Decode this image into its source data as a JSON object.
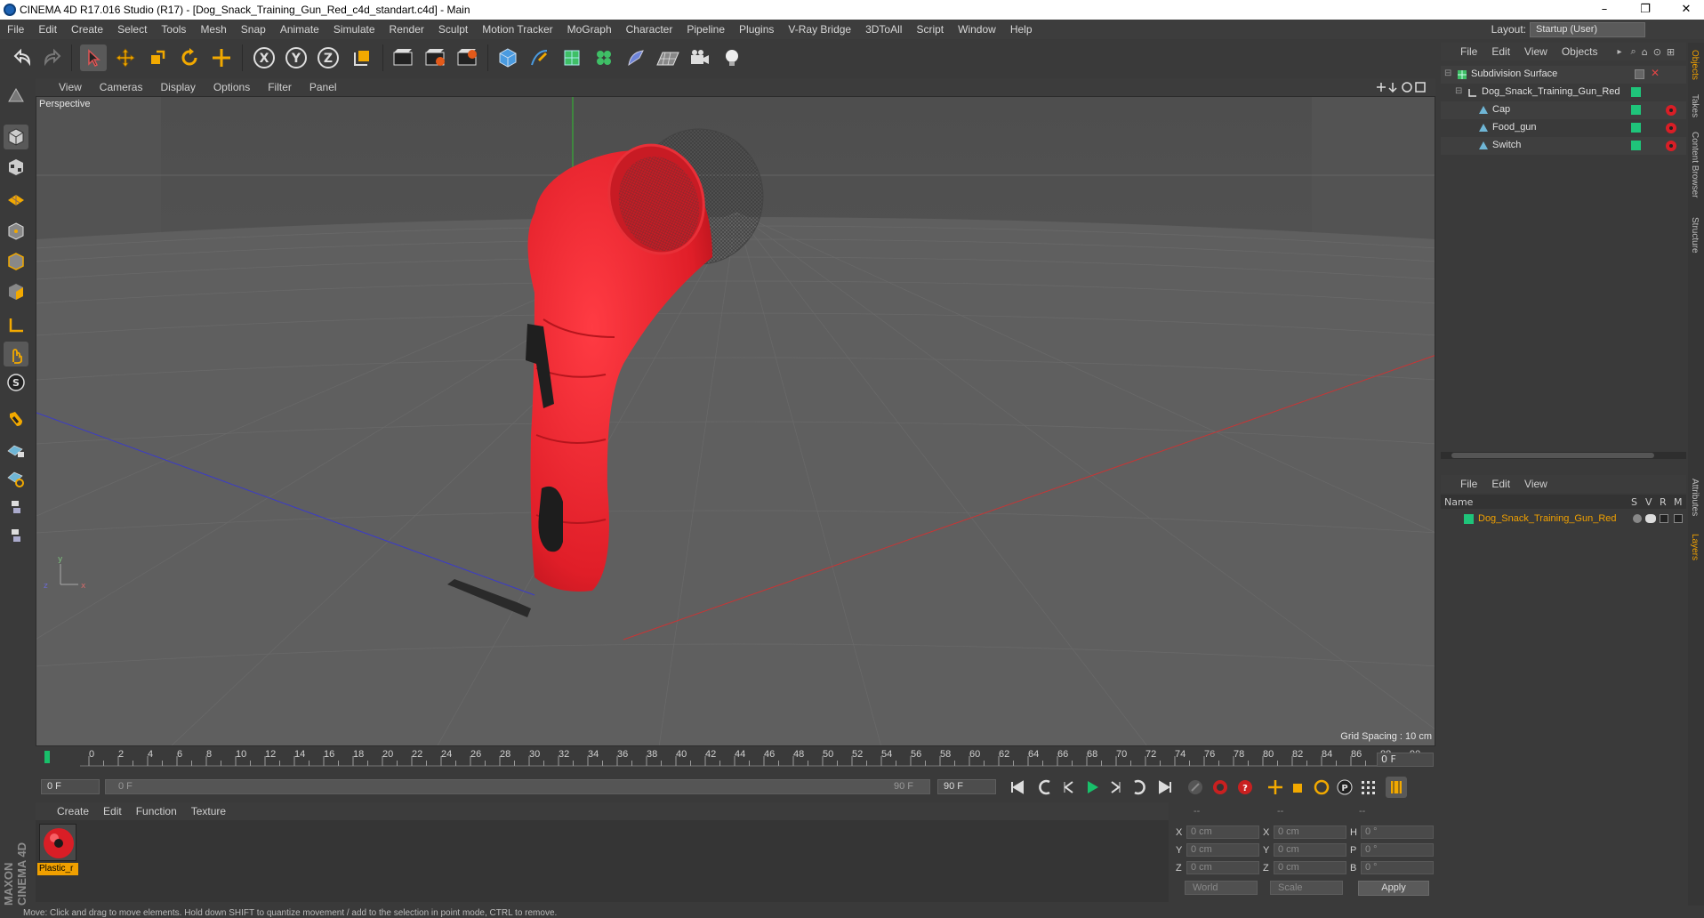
{
  "window": {
    "title": "CINEMA 4D R17.016 Studio (R17) - [Dog_Snack_Training_Gun_Red_c4d_standart.c4d] - Main",
    "minimize": "–",
    "maximize": "❐",
    "close": "✕"
  },
  "menu": [
    "File",
    "Edit",
    "Create",
    "Select",
    "Tools",
    "Mesh",
    "Snap",
    "Animate",
    "Simulate",
    "Render",
    "Sculpt",
    "Motion Tracker",
    "MoGraph",
    "Character",
    "Pipeline",
    "Plugins",
    "V-Ray Bridge",
    "3DToAll",
    "Script",
    "Window",
    "Help"
  ],
  "layout": {
    "label": "Layout:",
    "value": "Startup (User)"
  },
  "viewport": {
    "menu": [
      "View",
      "Cameras",
      "Display",
      "Options",
      "Filter",
      "Panel"
    ],
    "label": "Perspective",
    "grid_spacing": "Grid Spacing : 10 cm"
  },
  "timeline": {
    "ticks": [
      "0",
      "2",
      "4",
      "6",
      "8",
      "10",
      "12",
      "14",
      "16",
      "18",
      "20",
      "22",
      "24",
      "26",
      "28",
      "30",
      "32",
      "34",
      "36",
      "38",
      "40",
      "42",
      "44",
      "46",
      "48",
      "50",
      "52",
      "54",
      "56",
      "58",
      "60",
      "62",
      "64",
      "66",
      "68",
      "70",
      "72",
      "74",
      "76",
      "78",
      "80",
      "82",
      "84",
      "86",
      "88",
      "90"
    ],
    "current_frame": "0 F",
    "start": "0 F",
    "range_start": "0 F",
    "range_end": "90 F",
    "end": "90 F"
  },
  "materials": {
    "menu": [
      "Create",
      "Edit",
      "Function",
      "Texture"
    ],
    "items": [
      {
        "name": "Plastic_r"
      }
    ]
  },
  "coords": {
    "headers": [
      "--",
      "--",
      "--"
    ],
    "rows": [
      {
        "a": "X",
        "av": "0 cm",
        "b": "X",
        "bv": "0 cm",
        "c": "H",
        "cv": "0 °"
      },
      {
        "a": "Y",
        "av": "0 cm",
        "b": "Y",
        "bv": "0 cm",
        "c": "P",
        "cv": "0 °"
      },
      {
        "a": "Z",
        "av": "0 cm",
        "b": "Z",
        "bv": "0 cm",
        "c": "B",
        "cv": "0 °"
      }
    ],
    "space": "World",
    "mode": "Scale",
    "apply": "Apply"
  },
  "object_manager": {
    "menu": [
      "File",
      "Edit",
      "View",
      "Objects"
    ],
    "objects": [
      {
        "name": "Subdivision Surface",
        "depth": 0
      },
      {
        "name": "Dog_Snack_Training_Gun_Red",
        "depth": 1
      },
      {
        "name": "Cap",
        "depth": 2
      },
      {
        "name": "Food_gun",
        "depth": 2
      },
      {
        "name": "Switch",
        "depth": 2
      }
    ]
  },
  "layer_manager": {
    "menu": [
      "File",
      "Edit",
      "View"
    ],
    "columns": {
      "name": "Name",
      "s": "S",
      "v": "V",
      "r": "R",
      "m": "M"
    },
    "layers": [
      {
        "name": "Dog_Snack_Training_Gun_Red"
      }
    ]
  },
  "right_tabs": [
    "Objects",
    "Takes",
    "Content Browser",
    "Structure",
    "Attributes",
    "Layers"
  ],
  "status": "Move: Click and drag to move elements. Hold down SHIFT to quantize movement / add to the selection in point mode, CTRL to remove.",
  "brand": "MAXON CINEMA 4D",
  "colors": {
    "accent": "#f0a000",
    "object_red": "#e8212b",
    "layer_green": "#1fc47a"
  }
}
